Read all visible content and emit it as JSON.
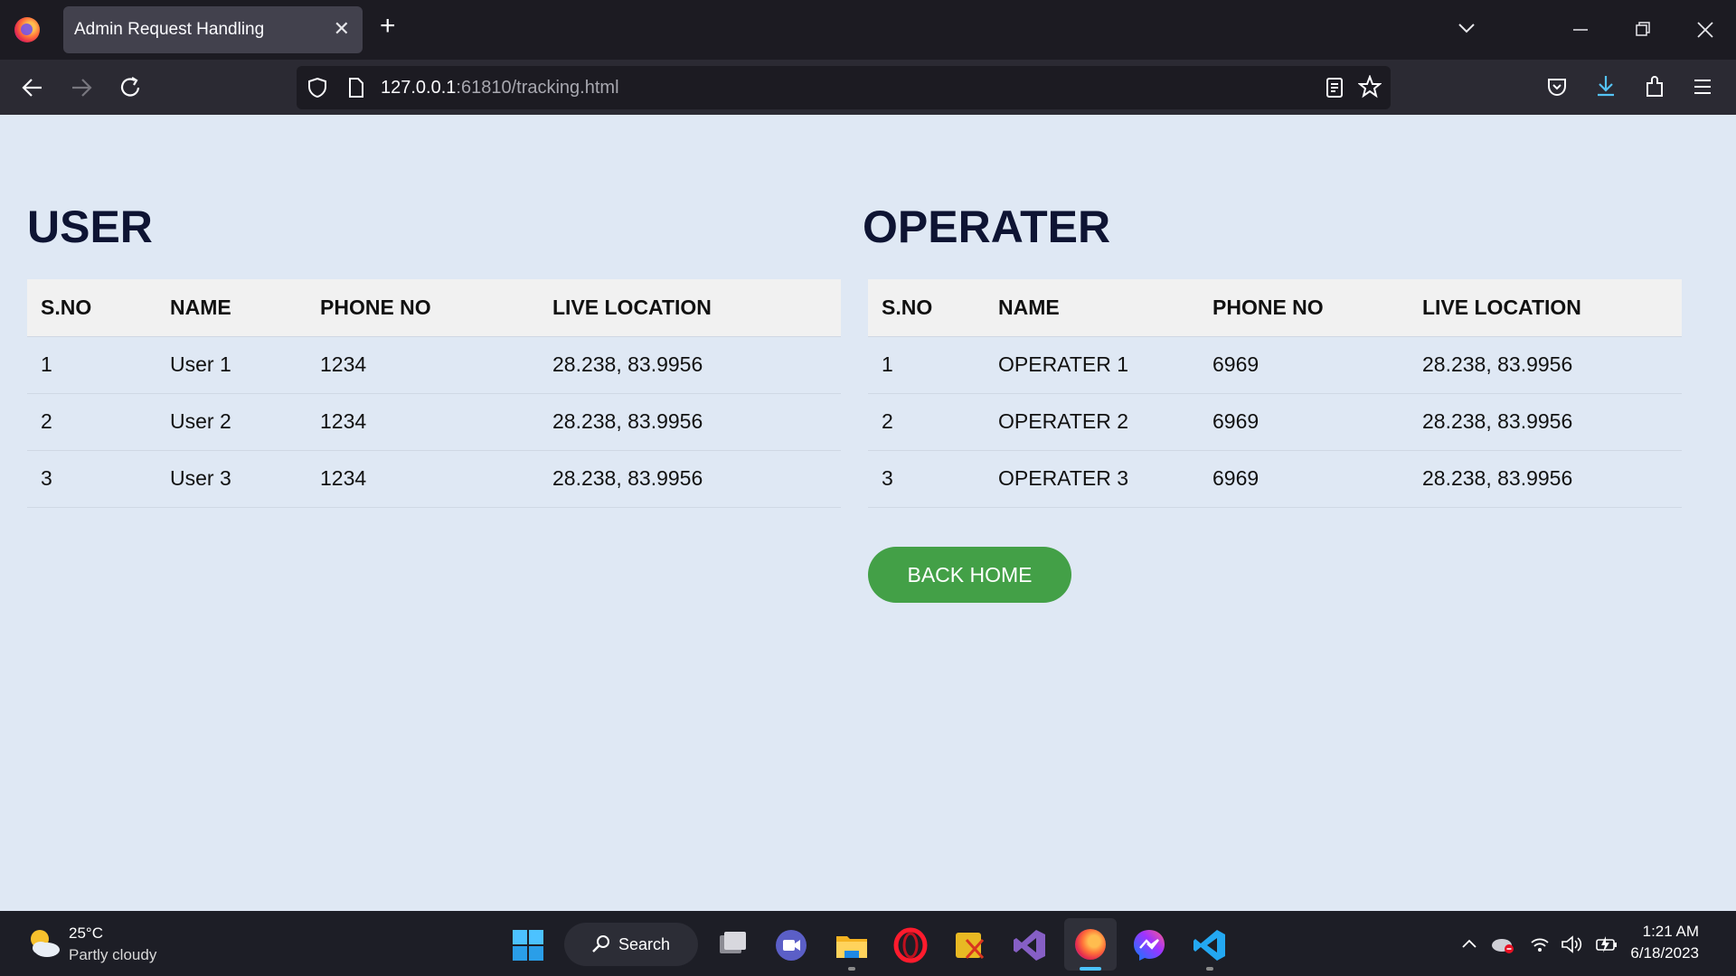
{
  "browser": {
    "tab_title": "Admin Request Handling",
    "url_host": "127.0.0.1",
    "url_rest": ":61810/tracking.html"
  },
  "user_section": {
    "title": "USER",
    "headers": [
      "S.NO",
      "NAME",
      "PHONE NO",
      "LIVE LOCATION"
    ],
    "rows": [
      [
        "1",
        "User 1",
        "1234",
        "28.238, 83.9956"
      ],
      [
        "2",
        "User 2",
        "1234",
        "28.238, 83.9956"
      ],
      [
        "3",
        "User 3",
        "1234",
        "28.238, 83.9956"
      ]
    ]
  },
  "operater_section": {
    "title": "OPERATER",
    "headers": [
      "S.NO",
      "NAME",
      "PHONE NO",
      "LIVE LOCATION"
    ],
    "rows": [
      [
        "1",
        "OPERATER 1",
        "6969",
        "28.238, 83.9956"
      ],
      [
        "2",
        "OPERATER 2",
        "6969",
        "28.238, 83.9956"
      ],
      [
        "3",
        "OPERATER 3",
        "6969",
        "28.238, 83.9956"
      ]
    ]
  },
  "back_button_label": "BACK HOME",
  "taskbar": {
    "weather_temp": "25°C",
    "weather_desc": "Partly cloudy",
    "search_label": "Search",
    "time": "1:21 AM",
    "date": "6/18/2023"
  },
  "colors": {
    "page_bg": "#dfe8f4",
    "button_green": "#43a047",
    "heading": "#0e1433"
  }
}
